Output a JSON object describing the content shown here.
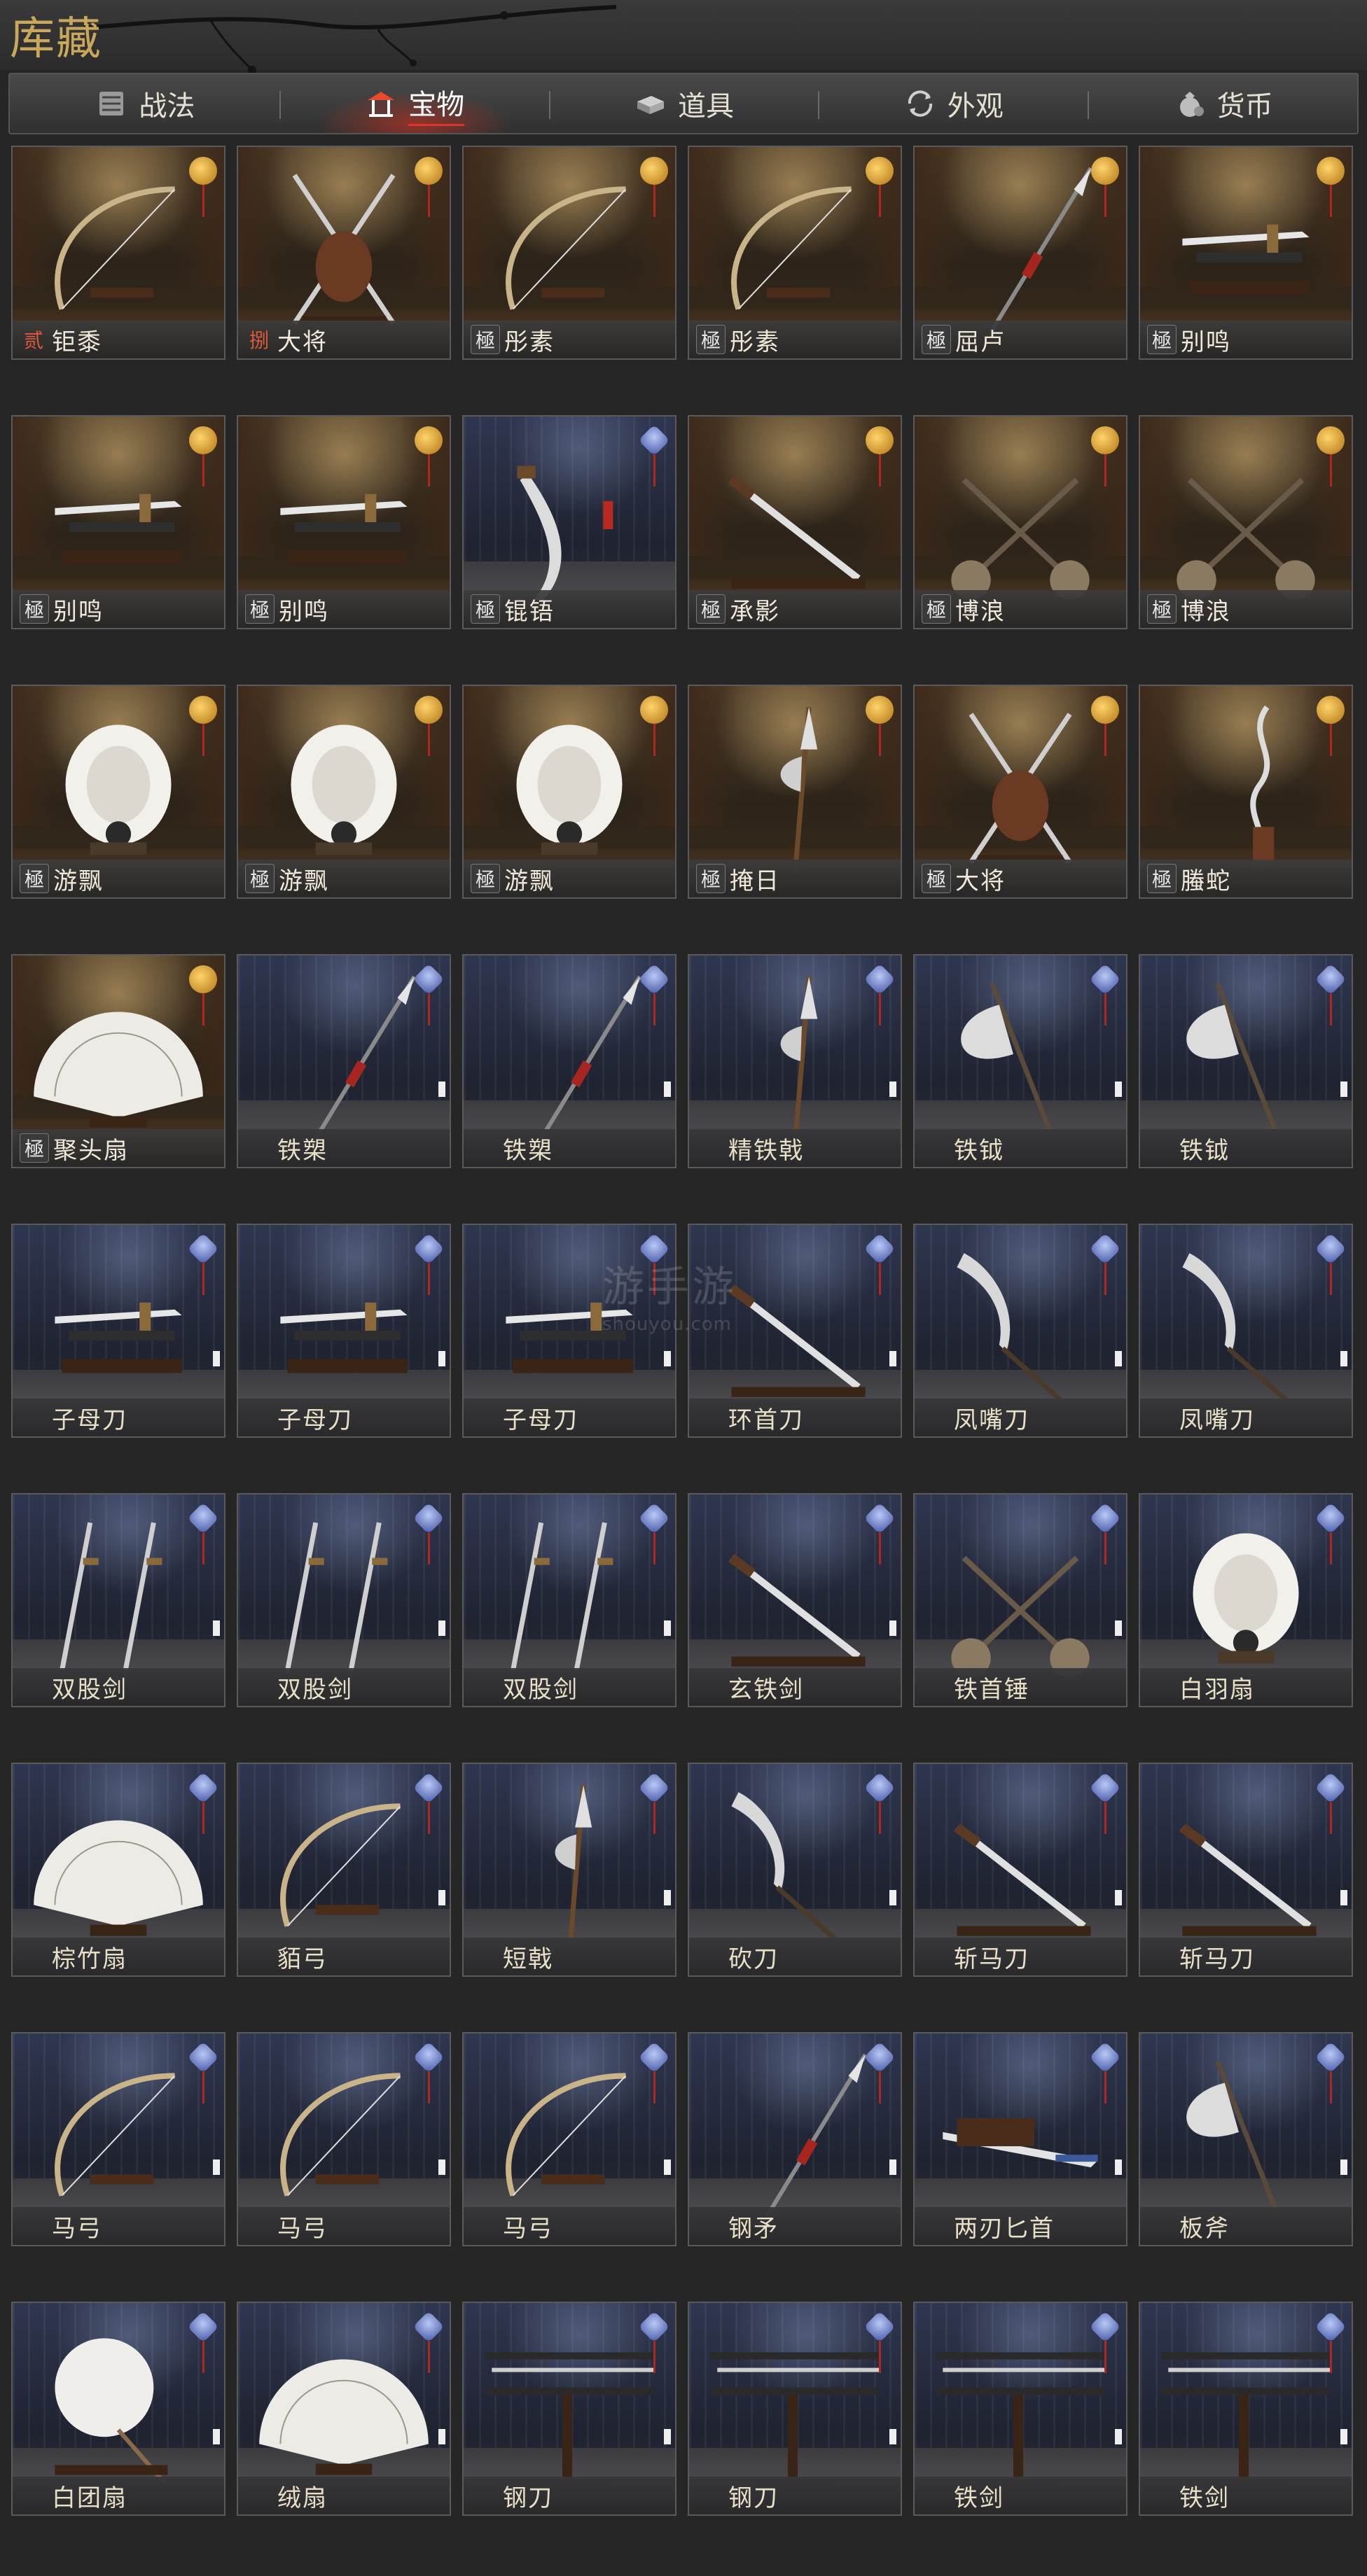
{
  "title": "库藏",
  "tabs": [
    {
      "label": "战法",
      "icon": "scroll-bundle-icon",
      "active": false
    },
    {
      "label": "宝物",
      "icon": "pavilion-icon",
      "active": true
    },
    {
      "label": "道具",
      "icon": "ingot-box-icon",
      "active": false
    },
    {
      "label": "外观",
      "icon": "cycle-icon",
      "active": false
    },
    {
      "label": "货币",
      "icon": "money-bag-icon",
      "active": false
    }
  ],
  "items": [
    {
      "grade": "贰",
      "name": "钜黍",
      "theme": "gold",
      "weapon": "bow"
    },
    {
      "grade": "捌",
      "name": "大将",
      "theme": "gold",
      "weapon": "cross"
    },
    {
      "grade": "極",
      "name": "彤素",
      "theme": "gold",
      "weapon": "bow"
    },
    {
      "grade": "極",
      "name": "彤素",
      "theme": "gold",
      "weapon": "bow"
    },
    {
      "grade": "極",
      "name": "屈卢",
      "theme": "gold",
      "weapon": "spear"
    },
    {
      "grade": "極",
      "name": "别鸣",
      "theme": "gold",
      "weapon": "sword-rack"
    },
    {
      "grade": "極",
      "name": "别鸣",
      "theme": "gold",
      "weapon": "sword-rack"
    },
    {
      "grade": "極",
      "name": "别鸣",
      "theme": "gold",
      "weapon": "sword-rack"
    },
    {
      "grade": "極",
      "name": "锟铻",
      "theme": "night",
      "weapon": "saber"
    },
    {
      "grade": "極",
      "name": "承影",
      "theme": "gold",
      "weapon": "sword"
    },
    {
      "grade": "極",
      "name": "博浪",
      "theme": "gold",
      "weapon": "hammers"
    },
    {
      "grade": "極",
      "name": "博浪",
      "theme": "gold",
      "weapon": "hammers"
    },
    {
      "grade": "極",
      "name": "游飘",
      "theme": "gold",
      "weapon": "fan"
    },
    {
      "grade": "極",
      "name": "游飘",
      "theme": "gold",
      "weapon": "fan"
    },
    {
      "grade": "極",
      "name": "游飘",
      "theme": "gold",
      "weapon": "fan"
    },
    {
      "grade": "極",
      "name": "掩日",
      "theme": "gold",
      "weapon": "halberd"
    },
    {
      "grade": "極",
      "name": "大将",
      "theme": "gold",
      "weapon": "cross"
    },
    {
      "grade": "極",
      "name": "螣蛇",
      "theme": "gold",
      "weapon": "snake-spear"
    },
    {
      "grade": "極",
      "name": "聚头扇",
      "theme": "gold",
      "weapon": "open-fan"
    },
    {
      "grade": "",
      "name": "铁槊",
      "theme": "blue",
      "weapon": "spear"
    },
    {
      "grade": "",
      "name": "铁槊",
      "theme": "blue",
      "weapon": "spear"
    },
    {
      "grade": "",
      "name": "精铁戟",
      "theme": "blue",
      "weapon": "halberd"
    },
    {
      "grade": "",
      "name": "铁钺",
      "theme": "blue",
      "weapon": "axe"
    },
    {
      "grade": "",
      "name": "铁钺",
      "theme": "blue",
      "weapon": "axe"
    },
    {
      "grade": "",
      "name": "子母刀",
      "theme": "blue",
      "weapon": "sword-rack"
    },
    {
      "grade": "",
      "name": "子母刀",
      "theme": "blue",
      "weapon": "sword-rack"
    },
    {
      "grade": "",
      "name": "子母刀",
      "theme": "blue",
      "weapon": "sword-rack"
    },
    {
      "grade": "",
      "name": "环首刀",
      "theme": "blue",
      "weapon": "sword"
    },
    {
      "grade": "",
      "name": "凤嘴刀",
      "theme": "blue",
      "weapon": "glaive"
    },
    {
      "grade": "",
      "name": "凤嘴刀",
      "theme": "blue",
      "weapon": "glaive"
    },
    {
      "grade": "",
      "name": "双股剑",
      "theme": "blue",
      "weapon": "twin-swords"
    },
    {
      "grade": "",
      "name": "双股剑",
      "theme": "blue",
      "weapon": "twin-swords"
    },
    {
      "grade": "",
      "name": "双股剑",
      "theme": "blue",
      "weapon": "twin-swords"
    },
    {
      "grade": "",
      "name": "玄铁剑",
      "theme": "blue",
      "weapon": "sword"
    },
    {
      "grade": "",
      "name": "铁首锤",
      "theme": "blue",
      "weapon": "hammers"
    },
    {
      "grade": "",
      "name": "白羽扇",
      "theme": "blue",
      "weapon": "fan"
    },
    {
      "grade": "",
      "name": "棕竹扇",
      "theme": "blue",
      "weapon": "open-fan"
    },
    {
      "grade": "",
      "name": "貊弓",
      "theme": "blue",
      "weapon": "bow"
    },
    {
      "grade": "",
      "name": "短戟",
      "theme": "blue",
      "weapon": "halberd"
    },
    {
      "grade": "",
      "name": "砍刀",
      "theme": "blue",
      "weapon": "glaive"
    },
    {
      "grade": "",
      "name": "斩马刀",
      "theme": "blue",
      "weapon": "sword"
    },
    {
      "grade": "",
      "name": "斩马刀",
      "theme": "blue",
      "weapon": "sword"
    },
    {
      "grade": "",
      "name": "马弓",
      "theme": "blue",
      "weapon": "bow"
    },
    {
      "grade": "",
      "name": "马弓",
      "theme": "blue",
      "weapon": "bow"
    },
    {
      "grade": "",
      "name": "马弓",
      "theme": "blue",
      "weapon": "bow"
    },
    {
      "grade": "",
      "name": "钢矛",
      "theme": "blue",
      "weapon": "spear"
    },
    {
      "grade": "",
      "name": "两刃匕首",
      "theme": "blue",
      "weapon": "dagger"
    },
    {
      "grade": "",
      "name": "板斧",
      "theme": "blue",
      "weapon": "axe"
    },
    {
      "grade": "",
      "name": "白团扇",
      "theme": "blue",
      "weapon": "round-fan"
    },
    {
      "grade": "",
      "name": "绒扇",
      "theme": "blue",
      "weapon": "open-fan"
    },
    {
      "grade": "",
      "name": "钢刀",
      "theme": "blue",
      "weapon": "blade-rack"
    },
    {
      "grade": "",
      "name": "钢刀",
      "theme": "blue",
      "weapon": "blade-rack"
    },
    {
      "grade": "",
      "name": "铁剑",
      "theme": "blue",
      "weapon": "blade-rack"
    },
    {
      "grade": "",
      "name": "铁剑",
      "theme": "blue",
      "weapon": "blade-rack"
    }
  ],
  "watermark": {
    "main": "游手游",
    "sub": "shouyou.com"
  },
  "colors": {
    "accent": "#c9a85c",
    "active_tab_glow": "#d33",
    "background": "#262626"
  }
}
